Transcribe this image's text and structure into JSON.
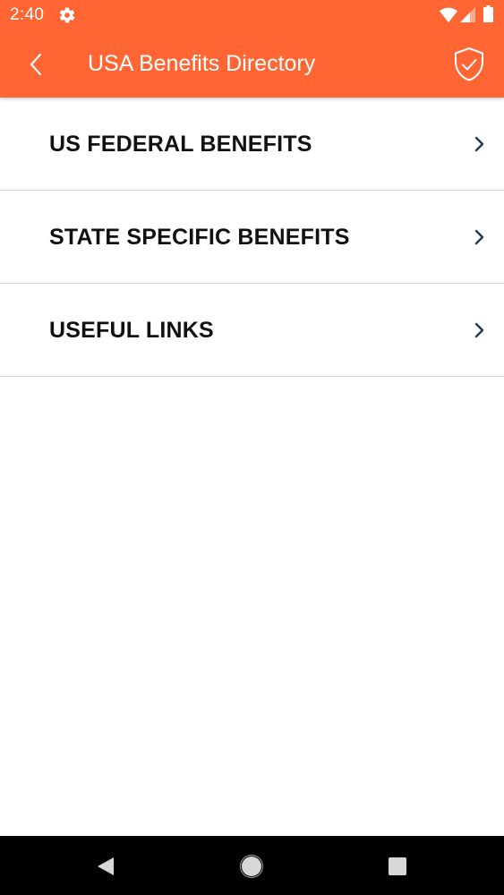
{
  "status_bar": {
    "time": "2:40",
    "icons": [
      "gear-icon",
      "wifi-icon",
      "cell-signal-icon",
      "battery-icon"
    ]
  },
  "app_bar": {
    "title": "USA Benefits Directory",
    "back_icon": "chevron-left-icon",
    "action_icon": "shield-check-icon",
    "color": "#ff6633"
  },
  "menu": {
    "items": [
      {
        "label": "US FEDERAL BENEFITS",
        "icon": "chevron-right-icon"
      },
      {
        "label": "STATE SPECIFIC BENEFITS",
        "icon": "chevron-right-icon"
      },
      {
        "label": "USEFUL LINKS",
        "icon": "chevron-right-icon"
      }
    ],
    "chevron_color": "#1f3a56"
  },
  "nav_bar": {
    "icons": [
      "nav-back-icon",
      "nav-home-icon",
      "nav-recents-icon"
    ]
  }
}
